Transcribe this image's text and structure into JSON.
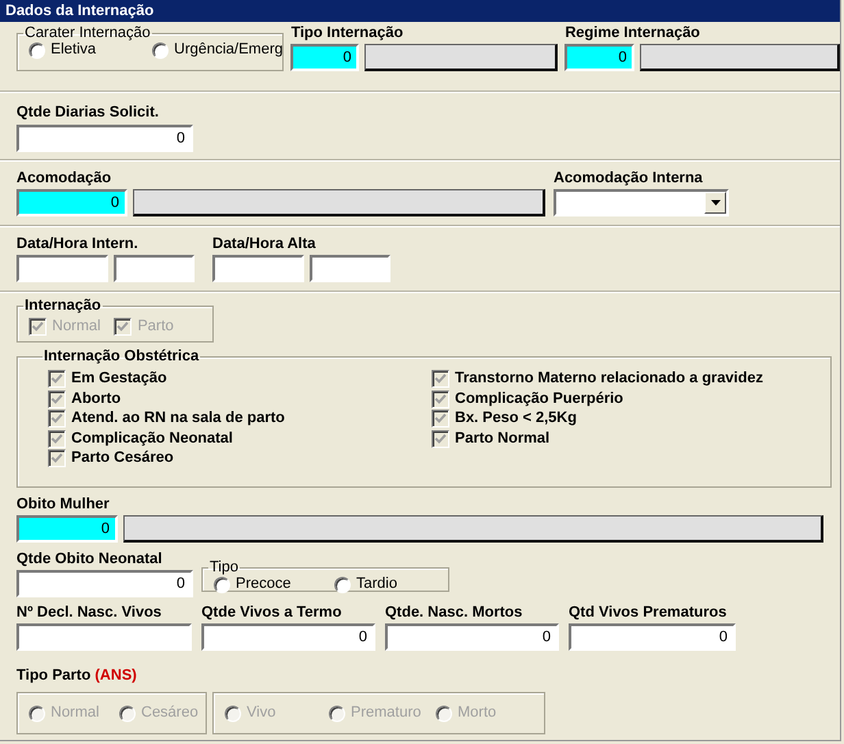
{
  "title": "Dados da Internação",
  "carater_internacao": {
    "legend": "Carater Internação",
    "options": [
      {
        "label": "Eletiva",
        "selected": false
      },
      {
        "label": "Urgência/Emerg",
        "selected": false
      }
    ]
  },
  "tipo_internacao": {
    "label": "Tipo Internação",
    "code": "0"
  },
  "regime_internacao": {
    "label": "Regime Internação",
    "code": "0"
  },
  "qtde_diarias": {
    "label": "Qtde Diarias Solicit.",
    "value": "0"
  },
  "acomodacao": {
    "label": "Acomodação",
    "code": "0"
  },
  "acomodacao_interna": {
    "label": "Acomodação Interna"
  },
  "data_hora_intern": {
    "label": "Data/Hora Intern."
  },
  "data_hora_alta": {
    "label": "Data/Hora Alta"
  },
  "internacao": {
    "legend": "Internação",
    "options": [
      {
        "label": "Normal",
        "checked": true,
        "disabled": true
      },
      {
        "label": "Parto",
        "checked": true,
        "disabled": true
      }
    ]
  },
  "internacao_obstetrica": {
    "legend": "Internação Obstétrica",
    "columns": [
      [
        {
          "label": "Em Gestação",
          "checked": true,
          "disabled": true
        },
        {
          "label": "Aborto",
          "checked": true,
          "disabled": true
        },
        {
          "label": "Atend. ao RN na sala de parto",
          "checked": true,
          "disabled": true
        },
        {
          "label": "Complicação Neonatal",
          "checked": true,
          "disabled": true
        },
        {
          "label": "Parto Cesáreo",
          "checked": true,
          "disabled": true
        }
      ],
      [
        {
          "label": "Transtorno Materno relacionado a gravidez",
          "checked": true,
          "disabled": true
        },
        {
          "label": "Complicação Puerpério",
          "checked": true,
          "disabled": true
        },
        {
          "label": "Bx. Peso < 2,5Kg",
          "checked": true,
          "disabled": true
        },
        {
          "label": "Parto Normal",
          "checked": true,
          "disabled": true
        }
      ]
    ]
  },
  "obito_mulher": {
    "label": "Obito Mulher",
    "code": "0"
  },
  "qtde_obito_neonatal": {
    "label": "Qtde Obito Neonatal",
    "value": "0"
  },
  "tipo_obito": {
    "legend": "Tipo",
    "options": [
      {
        "label": "Precoce",
        "selected": false
      },
      {
        "label": "Tardio",
        "selected": false
      }
    ]
  },
  "nascimentos": [
    {
      "label": "Nº Decl. Nasc. Vivos"
    },
    {
      "label": "Qtde Vivos a Termo",
      "value": "0"
    },
    {
      "label": "Qtde. Nasc. Mortos",
      "value": "0"
    },
    {
      "label": "Qtd Vivos Prematuros",
      "value": "0"
    }
  ],
  "tipo_parto": {
    "label": "Tipo Parto",
    "tag": "(ANS)",
    "groups": [
      [
        {
          "label": "Normal",
          "selected": false,
          "disabled": true
        },
        {
          "label": "Cesáreo",
          "selected": false,
          "disabled": true
        }
      ],
      [
        {
          "label": "Vivo",
          "selected": false,
          "disabled": true
        },
        {
          "label": "Prematuro",
          "selected": false,
          "disabled": true
        },
        {
          "label": "Morto",
          "selected": false,
          "disabled": true
        }
      ]
    ]
  }
}
